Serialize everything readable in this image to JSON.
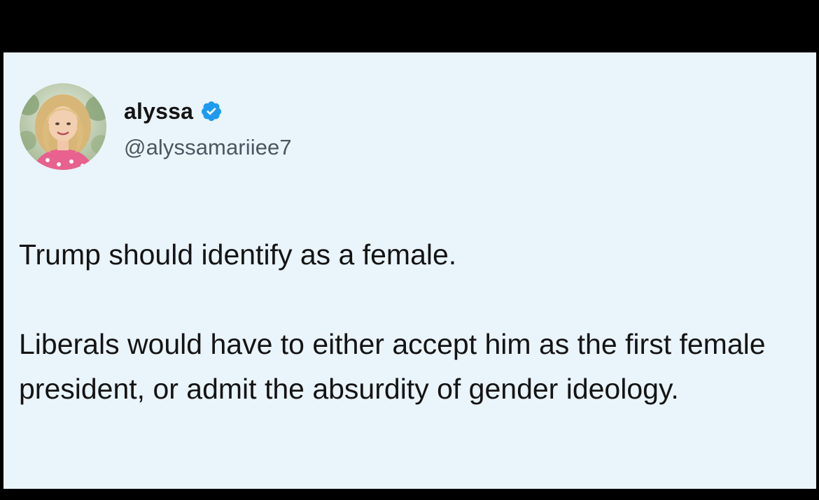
{
  "tweet": {
    "author": {
      "display_name": "alyssa",
      "handle": "@alyssamariiee7",
      "verified": true,
      "avatar_icon": "profile-photo-avatar",
      "badge_color": "#1d9bf0"
    },
    "paragraphs": [
      "Trump should identify as a female.",
      "Liberals would have to either accept him as the first female president, or admit the absurdity of gender ideology."
    ]
  },
  "colors": {
    "frame_background": "#000000",
    "card_background": "#eaf4fb",
    "text_primary": "#141414",
    "text_secondary": "#4c5660"
  }
}
